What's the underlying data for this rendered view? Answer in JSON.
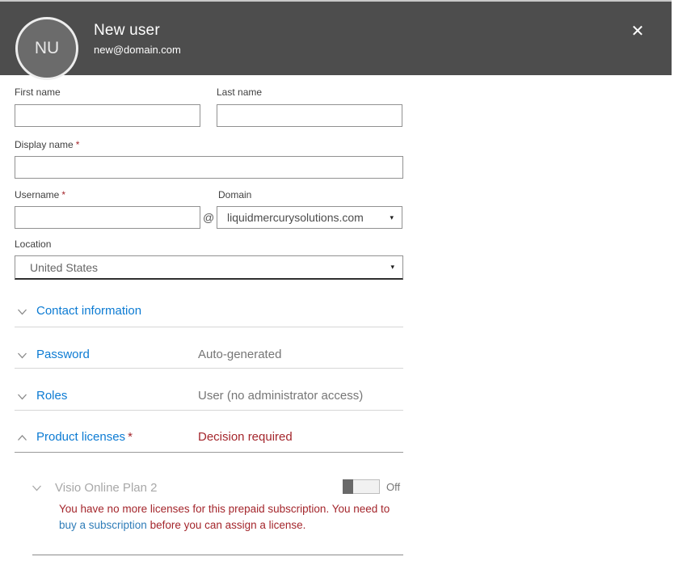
{
  "header": {
    "avatar_initials": "NU",
    "title": "New user",
    "subtitle": "new@domain.com",
    "close_label": "✕"
  },
  "form": {
    "first_name": {
      "label": "First name",
      "value": ""
    },
    "last_name": {
      "label": "Last name",
      "value": ""
    },
    "display_name": {
      "label": "Display name",
      "required_mark": "*",
      "value": ""
    },
    "username": {
      "label": "Username",
      "required_mark": "*",
      "value": ""
    },
    "at_symbol": "@",
    "domain": {
      "label": "Domain",
      "selected": "liquidmercurysolutions.com",
      "caret": "▾"
    },
    "location": {
      "label": "Location",
      "selected": "United States",
      "caret": "▾"
    }
  },
  "sections": [
    {
      "label": "Contact information",
      "value": "",
      "state": "collapsed"
    },
    {
      "label": "Password",
      "value": "Auto-generated",
      "state": "collapsed"
    },
    {
      "label": "Roles",
      "value": "User (no administrator access)",
      "state": "collapsed"
    },
    {
      "label": "Product licenses",
      "required_mark": "*",
      "value": "Decision required",
      "state": "expanded"
    }
  ],
  "product_licenses": {
    "license_name": "Visio Online Plan 2",
    "toggle_state": "Off",
    "warning_prefix": "You have no more licenses for this prepaid subscription. You need to ",
    "warning_link": "buy a subscription",
    "warning_suffix": " before you can assign a license."
  },
  "colors": {
    "header_bg": "#4d4d4d",
    "accent_blue": "#0c7bd3",
    "link_blue": "#2e7cb8",
    "error_red": "#a4262c",
    "secondary_gray": "#767676",
    "disabled_gray": "#a8a8a8"
  }
}
